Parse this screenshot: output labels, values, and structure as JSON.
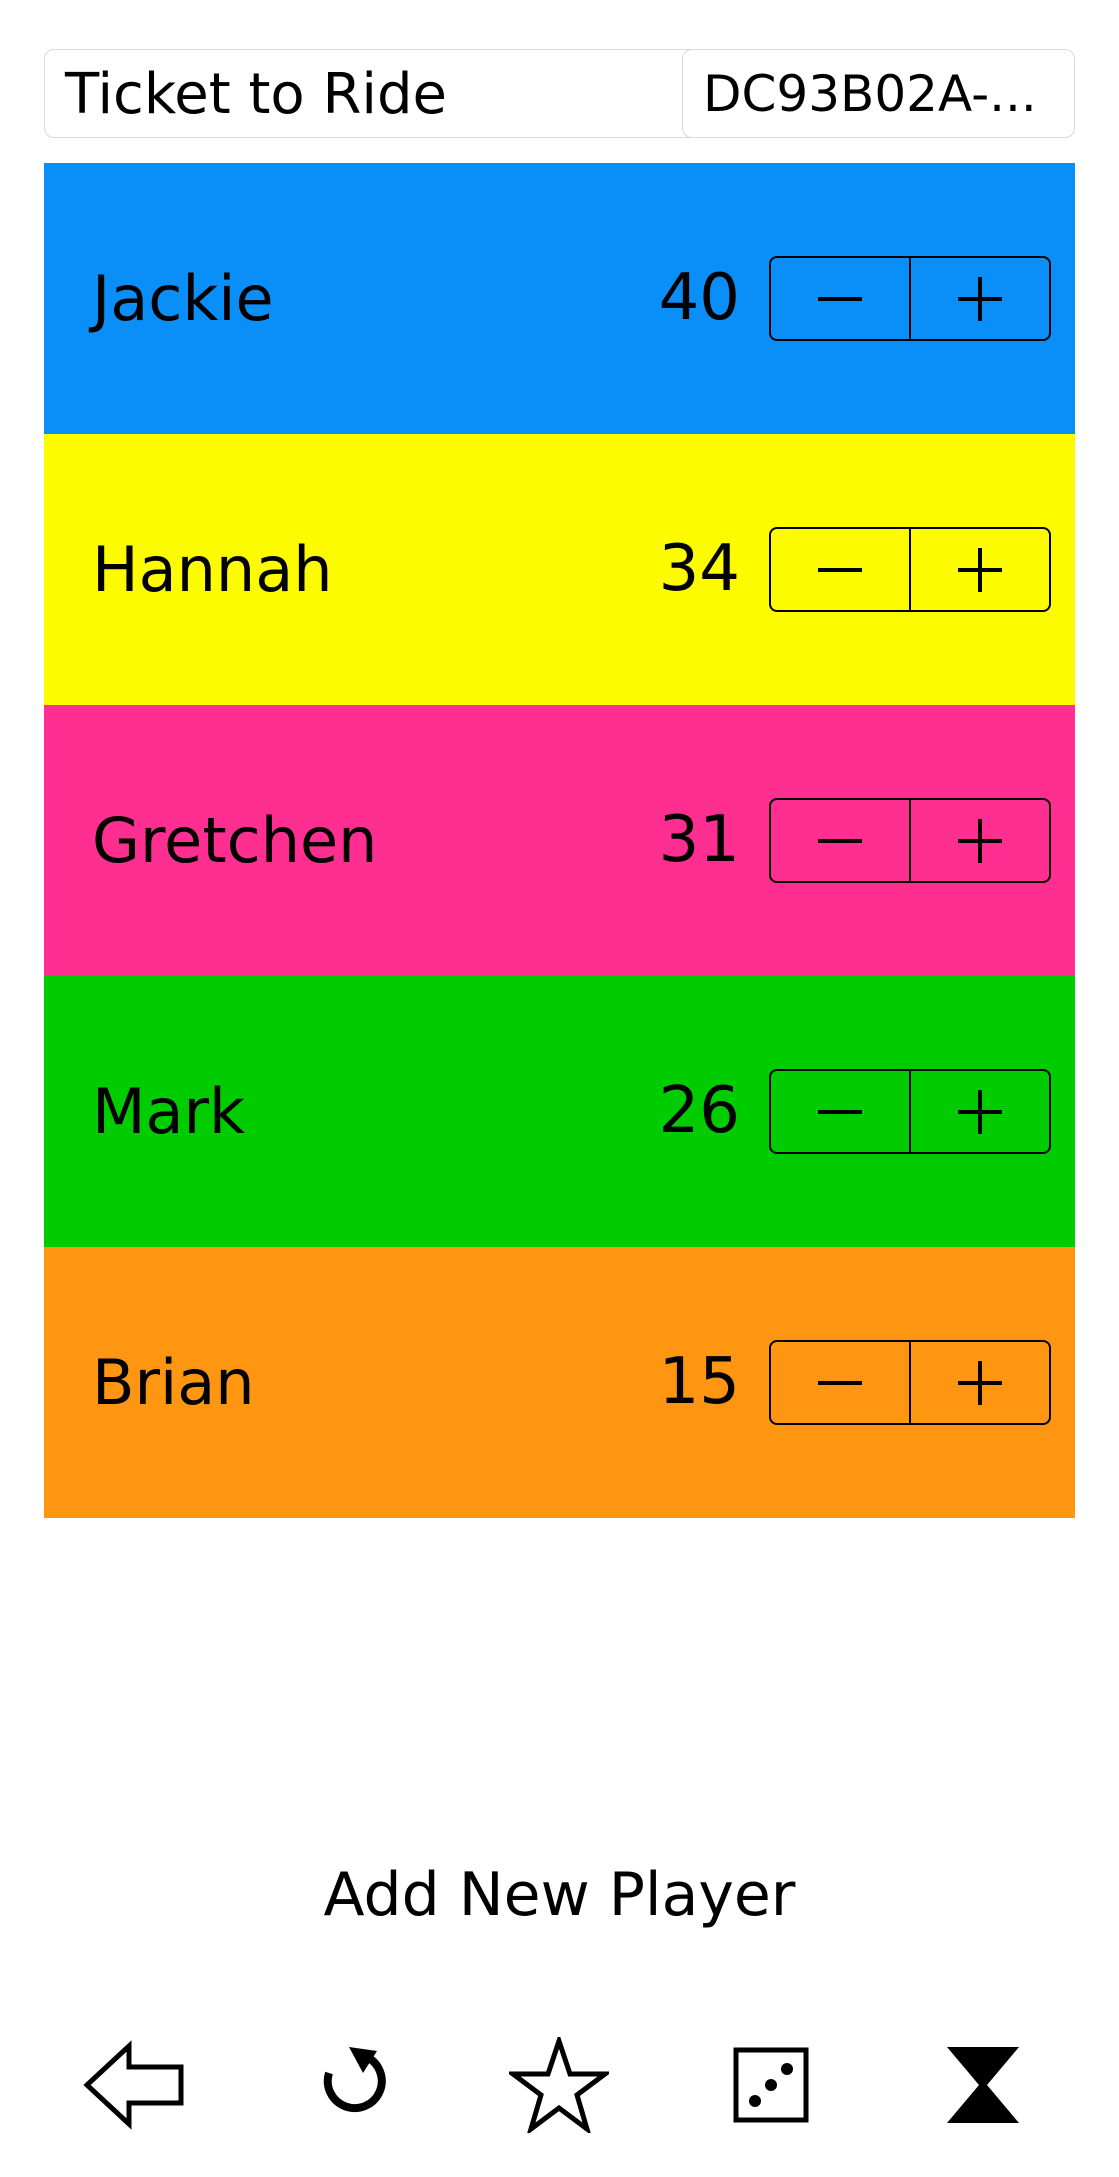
{
  "header": {
    "game_name": "Ticket to Ride",
    "game_id": "DC93B02A-..."
  },
  "players": [
    {
      "name": "Jackie",
      "score": "40",
      "color": "#0a8ef8"
    },
    {
      "name": "Hannah",
      "score": "34",
      "color": "#fdfb00"
    },
    {
      "name": "Gretchen",
      "score": "31",
      "color": "#ff2f92"
    },
    {
      "name": "Mark",
      "score": "26",
      "color": "#00cc00"
    },
    {
      "name": "Brian",
      "score": "15",
      "color": "#fe9612"
    }
  ],
  "stepper": {
    "minus_icon": "minus-icon",
    "plus_icon": "plus-icon"
  },
  "add_player_label": "Add New Player",
  "toolbar": {
    "icons": [
      "back-arrow-icon",
      "undo-icon",
      "star-icon",
      "dice-icon",
      "hourglass-icon"
    ]
  }
}
